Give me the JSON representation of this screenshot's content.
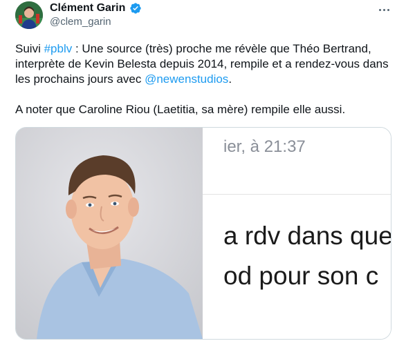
{
  "author": {
    "name": "Clément Garin",
    "handle": "@clem_garin",
    "verified_color": "#1d9bf0",
    "avatar_icon": "profile-avatar"
  },
  "more_icon": "more-horizontal-icon",
  "tweet": {
    "p1": {
      "lead": "Suivi ",
      "hashtag": "#pblv",
      "mid": " : Une source (très) proche me révèle que Théo Bertrand, interprète de Kevin Belesta depuis 2014, rempile et a rendez-vous dans les prochains jours avec ",
      "mention": "@newenstudios",
      "end": "."
    },
    "p2": "A noter que Caroline Riou (Laetitia, sa mère) rempile elle aussi."
  },
  "media": {
    "screenshot": {
      "line1": "ier, à 21:37",
      "line2": "a rdv dans que",
      "line3": "od pour son c"
    }
  },
  "colors": {
    "link": "#1d9bf0",
    "text": "#0f1419",
    "muted": "#536471",
    "border": "#cfd9de"
  }
}
